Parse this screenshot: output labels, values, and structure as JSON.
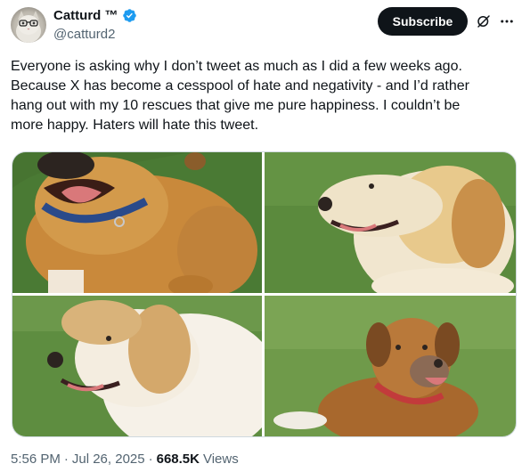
{
  "author": {
    "display_name": "Catturd ™",
    "handle": "@catturd2",
    "verified": true,
    "verified_color": "#1d9bf0"
  },
  "actions": {
    "subscribe_label": "Subscribe",
    "grok_icon": "grok-icon",
    "more_icon": "more-icon"
  },
  "tweet": {
    "text": "Everyone is asking why I don’t tweet as much as I did a few weeks ago.\nBecause X has become a cesspool of hate and negativity - and I’d rather\nhang out with my 10 rescues that give me pure happiness. I couldn’t be\nmore happy. Haters will hate this tweet.",
    "time": "5:56 PM",
    "date": "Jul 26, 2025",
    "separator": "·",
    "views_count": "668.5K",
    "views_label": "Views"
  },
  "colors": {
    "text_primary": "#0f1419",
    "text_secondary": "#536471",
    "border": "#cfd9de",
    "button_bg": "#0f1419"
  }
}
